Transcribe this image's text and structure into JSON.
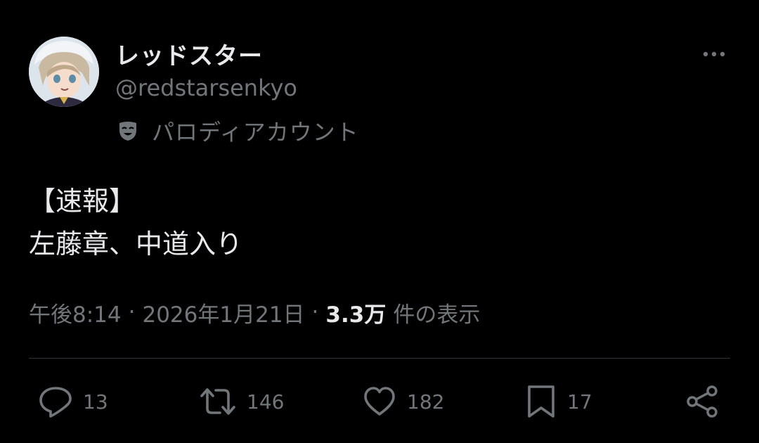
{
  "tweet": {
    "author": {
      "display_name": "レッドスター",
      "handle": "@redstarsenkyo",
      "avatar_icon": "avatar-illustration",
      "parody_icon": "theater-mask-icon",
      "parody_label": "パロディアカウント"
    },
    "more_icon": "more-horizontal-icon",
    "text_lines": [
      "【速報】",
      "左藤章、中道入り"
    ],
    "meta": {
      "time": "午後8:14",
      "separator": "·",
      "date": "2026年1月21日",
      "views_count": "3.3万",
      "views_label": "件の表示"
    },
    "actions": {
      "reply": {
        "icon": "reply-icon",
        "count": "13"
      },
      "retweet": {
        "icon": "retweet-icon",
        "count": "146"
      },
      "like": {
        "icon": "heart-icon",
        "count": "182"
      },
      "bookmark": {
        "icon": "bookmark-icon",
        "count": "17"
      },
      "share": {
        "icon": "share-icon"
      }
    }
  },
  "colors": {
    "background": "#000000",
    "text_primary": "#e7e9ea",
    "text_secondary": "#71767b",
    "divider": "#2f3336"
  }
}
